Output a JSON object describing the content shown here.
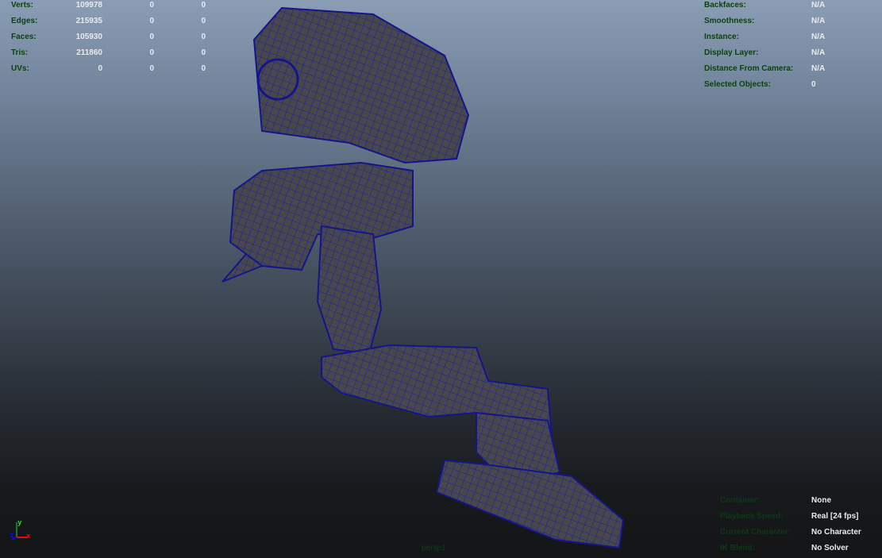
{
  "stats": [
    {
      "label": "Verts:",
      "values": [
        "109978",
        "0",
        "0"
      ]
    },
    {
      "label": "Edges:",
      "values": [
        "215935",
        "0",
        "0"
      ]
    },
    {
      "label": "Faces:",
      "values": [
        "105930",
        "0",
        "0"
      ]
    },
    {
      "label": "Tris:",
      "values": [
        "211860",
        "0",
        "0"
      ]
    },
    {
      "label": "UVs:",
      "values": [
        "0",
        "0",
        "0"
      ]
    }
  ],
  "info": [
    {
      "label": "Backfaces:",
      "value": "N/A"
    },
    {
      "label": "Smoothness:",
      "value": "N/A"
    },
    {
      "label": "Instance:",
      "value": "N/A"
    },
    {
      "label": "Display Layer:",
      "value": "N/A"
    },
    {
      "label": "Distance From Camera:",
      "value": "N/A"
    },
    {
      "label": "Selected Objects:",
      "value": "0"
    }
  ],
  "bottom_info": [
    {
      "label": "Container:",
      "value": "None"
    },
    {
      "label": "Playback Speed:",
      "value": "Real [24 fps]"
    },
    {
      "label": "Current Character:",
      "value": "No Character"
    },
    {
      "label": "IK Blend:",
      "value": "No Solver"
    }
  ],
  "camera": "persp1",
  "axes": {
    "x": "x",
    "y": "y",
    "z": "z"
  },
  "colors": {
    "wire": "#1a1a9a",
    "mesh": "#4a4a4e"
  }
}
